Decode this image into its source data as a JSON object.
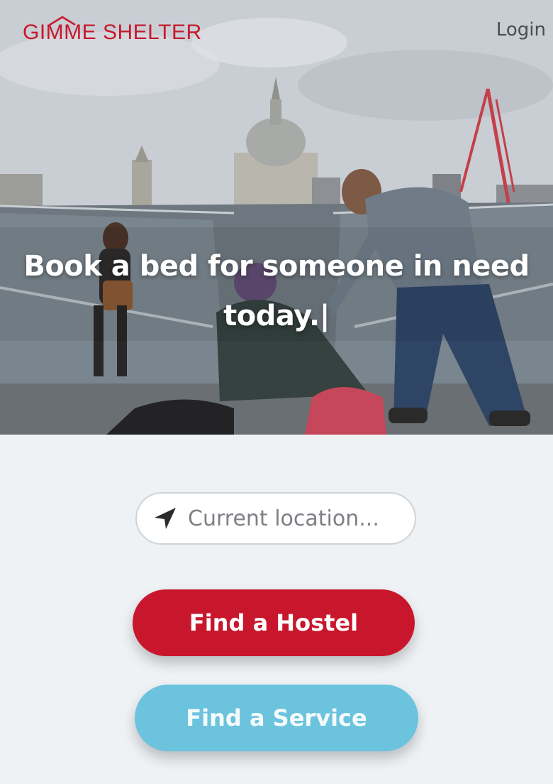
{
  "header": {
    "logo_text": "GIMME SHELTER",
    "login_label": "Login"
  },
  "hero": {
    "headline_line1": "Book a bed for someone in need",
    "headline_line2": "today.|"
  },
  "search": {
    "placeholder": "Current location...",
    "value": "",
    "icon": "location-arrow-icon"
  },
  "actions": {
    "find_hostel_label": "Find a Hostel",
    "find_service_label": "Find a Service"
  },
  "colors": {
    "brand_red": "#c8172d",
    "service_blue": "#6cc3dd",
    "page_background": "#eff2f5"
  }
}
